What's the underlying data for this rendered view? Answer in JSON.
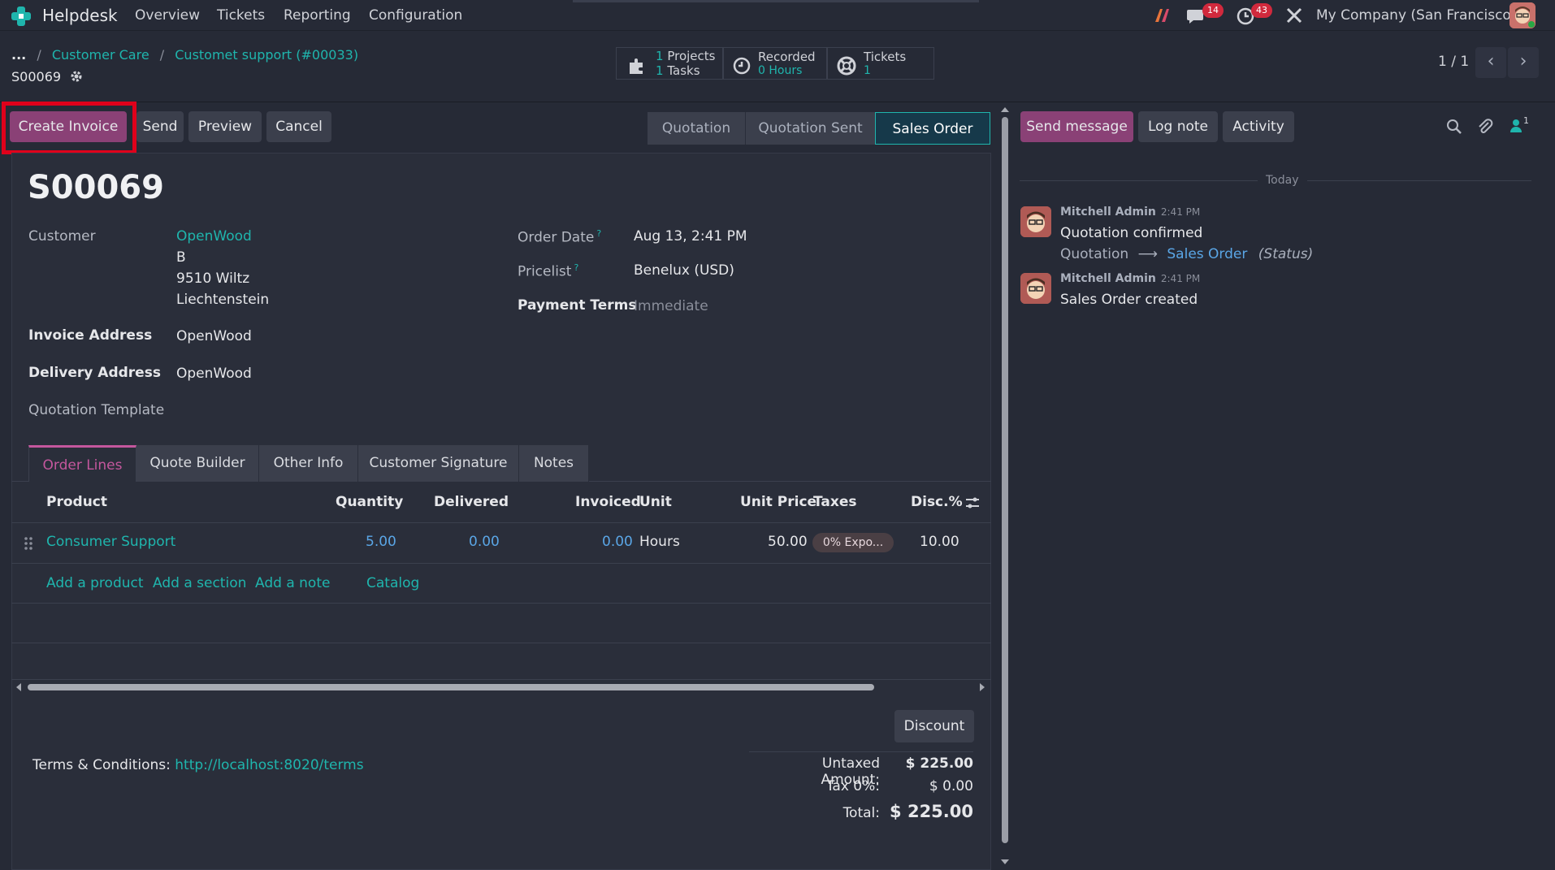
{
  "nav": {
    "app": "Helpdesk",
    "menu": [
      "Overview",
      "Tickets",
      "Reporting",
      "Configuration"
    ],
    "chat_count": "14",
    "activity_count": "43",
    "company": "My Company (San Francisco)"
  },
  "breadcrumb": {
    "ellipsis": "...",
    "items": [
      "Customer Care",
      "Customet support (#00033)"
    ],
    "record": "S00069"
  },
  "stats": {
    "projects_count": "1",
    "projects_label": "Projects",
    "tasks_count": "1",
    "tasks_label": "Tasks",
    "recorded_label": "Recorded",
    "recorded_value": "0 Hours",
    "tickets_label": "Tickets",
    "tickets_value": "1"
  },
  "pager": {
    "value": "1 / 1"
  },
  "actions": {
    "create_invoice": "Create Invoice",
    "send": "Send",
    "preview": "Preview",
    "cancel": "Cancel"
  },
  "stages": [
    "Quotation",
    "Quotation Sent",
    "Sales Order"
  ],
  "chatter_actions": {
    "send_message": "Send message",
    "log_note": "Log note",
    "activity": "Activity",
    "followers": "1"
  },
  "form": {
    "title": "S00069",
    "customer_label": "Customer",
    "customer_name": "OpenWood",
    "customer_addr": [
      "B",
      "9510 Wiltz",
      "Liechtenstein"
    ],
    "invoice_address_label": "Invoice Address",
    "invoice_address": "OpenWood",
    "delivery_address_label": "Delivery Address",
    "delivery_address": "OpenWood",
    "quotation_template_label": "Quotation Template",
    "order_date_label": "Order Date",
    "order_date": "Aug 13, 2:41 PM",
    "pricelist_label": "Pricelist",
    "pricelist": "Benelux (USD)",
    "payment_terms_label": "Payment Terms",
    "payment_terms": "Immediate",
    "help_mark": "?"
  },
  "tabs": [
    "Order Lines",
    "Quote Builder",
    "Other Info",
    "Customer Signature",
    "Notes"
  ],
  "table": {
    "headers": [
      "Product",
      "Quantity",
      "Delivered",
      "Invoiced",
      "Unit",
      "Unit Price",
      "Taxes",
      "Disc.%"
    ],
    "rows": [
      {
        "product": "Consumer Support",
        "quantity": "5.00",
        "delivered": "0.00",
        "invoiced": "0.00",
        "unit": "Hours",
        "unit_price": "50.00",
        "taxes": "0% Expo...",
        "discount": "10.00"
      }
    ],
    "add_links": [
      "Add a product",
      "Add a section",
      "Add a note",
      "Catalog"
    ]
  },
  "footer": {
    "discount_button": "Discount",
    "terms_label": "Terms & Conditions:",
    "terms_link": "http://localhost:8020/terms",
    "untaxed_label": "Untaxed Amount:",
    "untaxed_value": "$ 225.00",
    "tax_label": "Tax 0%:",
    "tax_value": "$ 0.00",
    "total_label": "Total:",
    "total_value": "$ 225.00"
  },
  "chatter": {
    "today": "Today",
    "messages": [
      {
        "author": "Mitchell Admin",
        "time": "2:41 PM",
        "body": "Quotation confirmed",
        "track_old": "Quotation",
        "track_new": "Sales Order",
        "track_field": "(Status)"
      },
      {
        "author": "Mitchell Admin",
        "time": "2:41 PM",
        "body": "Sales Order created"
      }
    ]
  },
  "colors": {
    "primary": "#8a4176",
    "accent": "#1fb5ad",
    "background": "#262a36",
    "highlight": "#e0001b"
  }
}
